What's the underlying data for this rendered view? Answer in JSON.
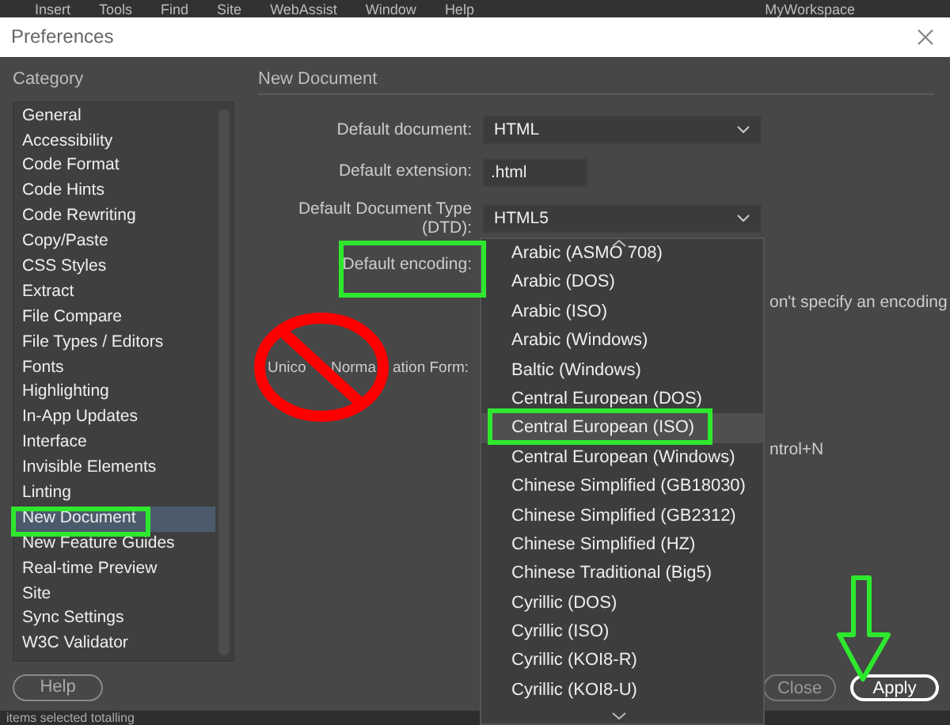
{
  "menu_bar": {
    "items": [
      "Insert",
      "Tools",
      "Find",
      "Site",
      "WebAssist",
      "Window",
      "Help"
    ],
    "workspace": "MyWorkspace"
  },
  "window": {
    "title": "Preferences"
  },
  "sidebar": {
    "heading": "Category",
    "items": [
      {
        "label": "General",
        "selected": false
      },
      {
        "label": "Accessibility",
        "selected": false
      },
      {
        "label": "Code Format",
        "selected": false
      },
      {
        "label": "Code Hints",
        "selected": false
      },
      {
        "label": "Code Rewriting",
        "selected": false
      },
      {
        "label": "Copy/Paste",
        "selected": false
      },
      {
        "label": "CSS Styles",
        "selected": false
      },
      {
        "label": "Extract",
        "selected": false
      },
      {
        "label": "File Compare",
        "selected": false
      },
      {
        "label": "File Types / Editors",
        "selected": false
      },
      {
        "label": "Fonts",
        "selected": false
      },
      {
        "label": "Highlighting",
        "selected": false
      },
      {
        "label": "In-App Updates",
        "selected": false
      },
      {
        "label": "Interface",
        "selected": false
      },
      {
        "label": "Invisible Elements",
        "selected": false
      },
      {
        "label": "Linting",
        "selected": false
      },
      {
        "label": "New Document",
        "selected": true
      },
      {
        "label": "New Feature Guides",
        "selected": false
      },
      {
        "label": "Real-time Preview",
        "selected": false
      },
      {
        "label": "Site",
        "selected": false
      },
      {
        "label": "Sync Settings",
        "selected": false
      },
      {
        "label": "W3C Validator",
        "selected": false
      }
    ],
    "help_button": "Help"
  },
  "panel": {
    "heading": "New Document",
    "fields": [
      {
        "kind": "dropdown",
        "label": "Default document:",
        "value": "HTML"
      },
      {
        "kind": "text",
        "label": "Default extension:",
        "value": ".html"
      },
      {
        "kind": "dropdown",
        "label": "Default Document Type (DTD):",
        "value": "HTML5"
      },
      {
        "kind": "label",
        "label": "Default encoding:"
      }
    ],
    "partial_texts": [
      "on't specify an encoding",
      "ntrol+N"
    ],
    "unicode_label_parts": [
      "Unico",
      "Norma",
      "ation Form:"
    ]
  },
  "encoding_list": {
    "items": [
      {
        "label": "Arabic (ASMO 708)",
        "selected": false
      },
      {
        "label": "Arabic (DOS)",
        "selected": false
      },
      {
        "label": "Arabic (ISO)",
        "selected": false
      },
      {
        "label": "Arabic (Windows)",
        "selected": false
      },
      {
        "label": "Baltic (Windows)",
        "selected": false
      },
      {
        "label": "Central European (DOS)",
        "selected": false
      },
      {
        "label": "Central European (ISO)",
        "selected": true
      },
      {
        "label": "Central European (Windows)",
        "selected": false
      },
      {
        "label": "Chinese Simplified (GB18030)",
        "selected": false
      },
      {
        "label": "Chinese Simplified (GB2312)",
        "selected": false
      },
      {
        "label": "Chinese Simplified (HZ)",
        "selected": false
      },
      {
        "label": "Chinese Traditional (Big5)",
        "selected": false
      },
      {
        "label": "Cyrillic (DOS)",
        "selected": false
      },
      {
        "label": "Cyrillic (ISO)",
        "selected": false
      },
      {
        "label": "Cyrillic (KOI8-R)",
        "selected": false
      },
      {
        "label": "Cyrillic (KOI8-U)",
        "selected": false
      }
    ]
  },
  "buttons": [
    "Close",
    "Apply"
  ],
  "status_bar": "items selected totalling"
}
